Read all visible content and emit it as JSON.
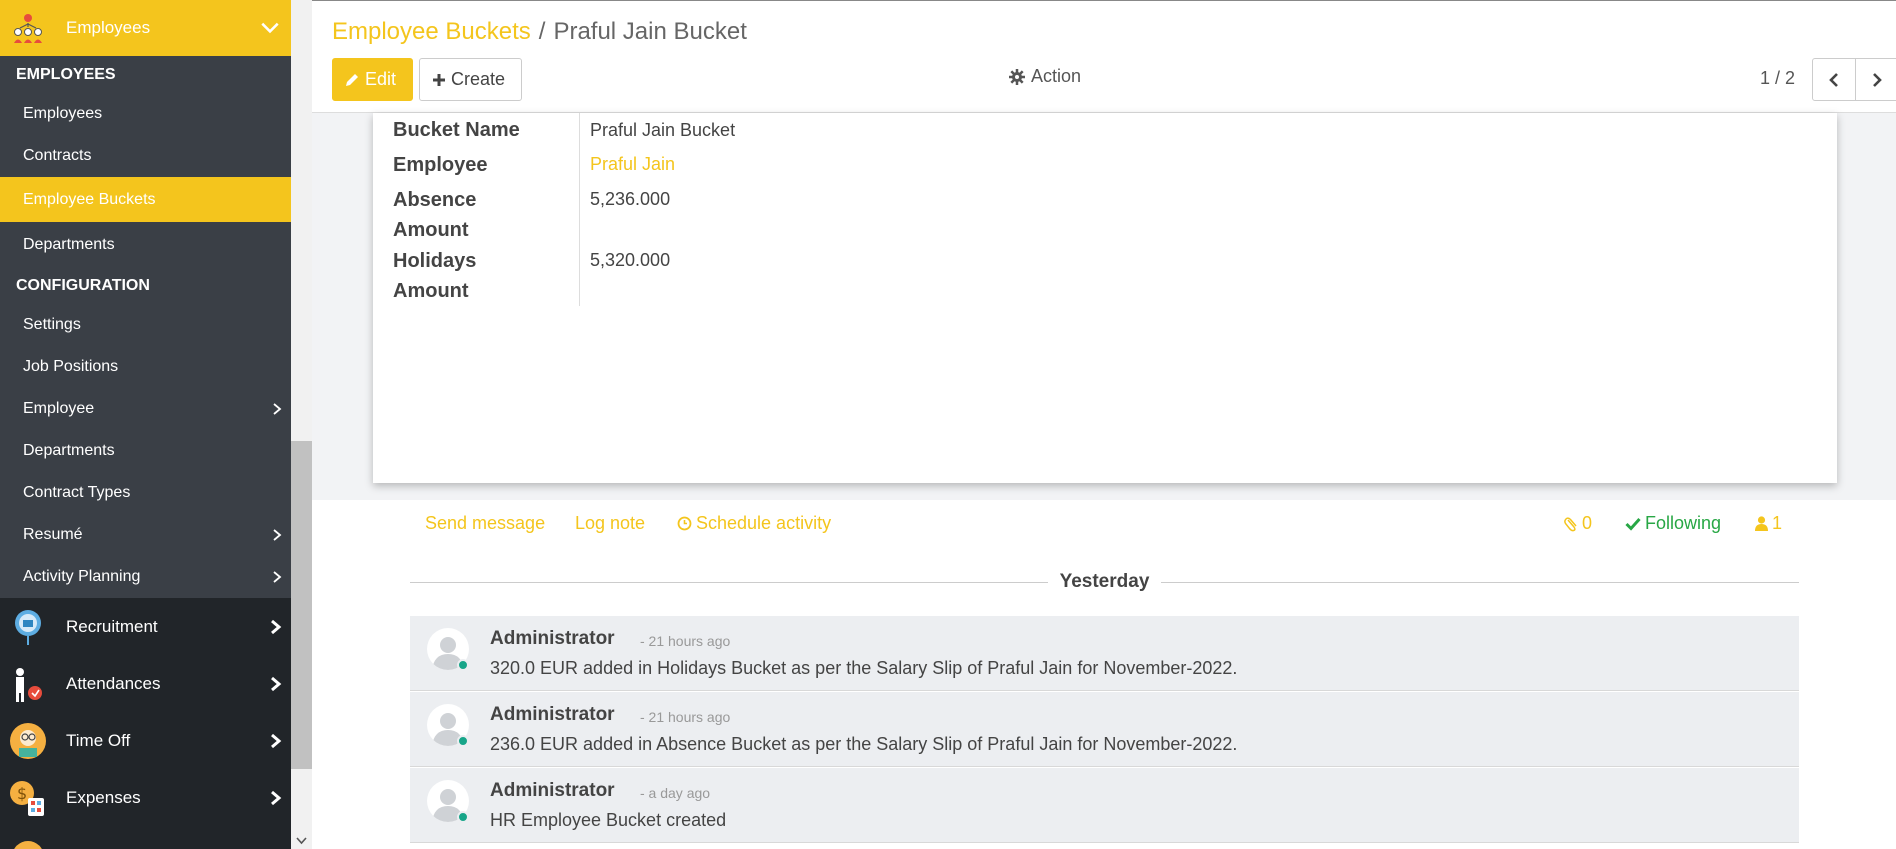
{
  "sidebar": {
    "app_name": "Employees",
    "sections": [
      {
        "title": "EMPLOYEES"
      },
      {
        "title": "CONFIGURATION"
      }
    ],
    "employees_items": [
      {
        "label": "Employees"
      },
      {
        "label": "Contracts"
      },
      {
        "label": "Employee Buckets",
        "active": true
      },
      {
        "label": "Departments"
      }
    ],
    "config_items": [
      {
        "label": "Settings"
      },
      {
        "label": "Job Positions"
      },
      {
        "label": "Employee"
      },
      {
        "label": "Departments"
      },
      {
        "label": "Contract Types"
      },
      {
        "label": "Resumé"
      },
      {
        "label": "Activity Planning"
      }
    ],
    "apps": [
      {
        "label": "Recruitment",
        "icon": "recruitment-icon"
      },
      {
        "label": "Attendances",
        "icon": "attendances-icon"
      },
      {
        "label": "Time Off",
        "icon": "time-off-icon"
      },
      {
        "label": "Expenses",
        "icon": "expenses-icon"
      }
    ]
  },
  "header": {
    "breadcrumb_parent": "Employee Buckets",
    "breadcrumb_sep": "/",
    "breadcrumb_current": "Praful Jain Bucket",
    "edit_label": "Edit",
    "create_label": "Create",
    "action_label": "Action",
    "pager": "1 / 2"
  },
  "form": {
    "fields": [
      {
        "label": "Bucket Name",
        "value": "Praful Jain Bucket"
      },
      {
        "label": "Employee",
        "value": "Praful Jain"
      },
      {
        "label_line1": "Absence",
        "label_line2": "Amount",
        "value": "5,236.000"
      },
      {
        "label_line1": "Holidays",
        "label_line2": "Amount",
        "value": "5,320.000"
      }
    ]
  },
  "chatter": {
    "send_message": "Send message",
    "log_note": "Log note",
    "schedule_activity": "Schedule activity",
    "attachments_count": "0",
    "following_label": "Following",
    "followers_count": "1",
    "day_label": "Yesterday",
    "messages": [
      {
        "author": "Administrator",
        "time": "- 21 hours ago",
        "body": "320.0 EUR added in Holidays Bucket as per the Salary Slip of Praful Jain for November-2022."
      },
      {
        "author": "Administrator",
        "time": "- 21 hours ago",
        "body": "236.0 EUR added in Absence Bucket as per the Salary Slip of Praful Jain for November-2022."
      },
      {
        "author": "Administrator",
        "time": "- a day ago",
        "body": "HR Employee Bucket created"
      }
    ]
  },
  "colors": {
    "brand": "#f4c51d",
    "sidebar_dark": "#212529",
    "submenu": "#3a3f46",
    "success": "#28a745",
    "online": "#17a589"
  }
}
